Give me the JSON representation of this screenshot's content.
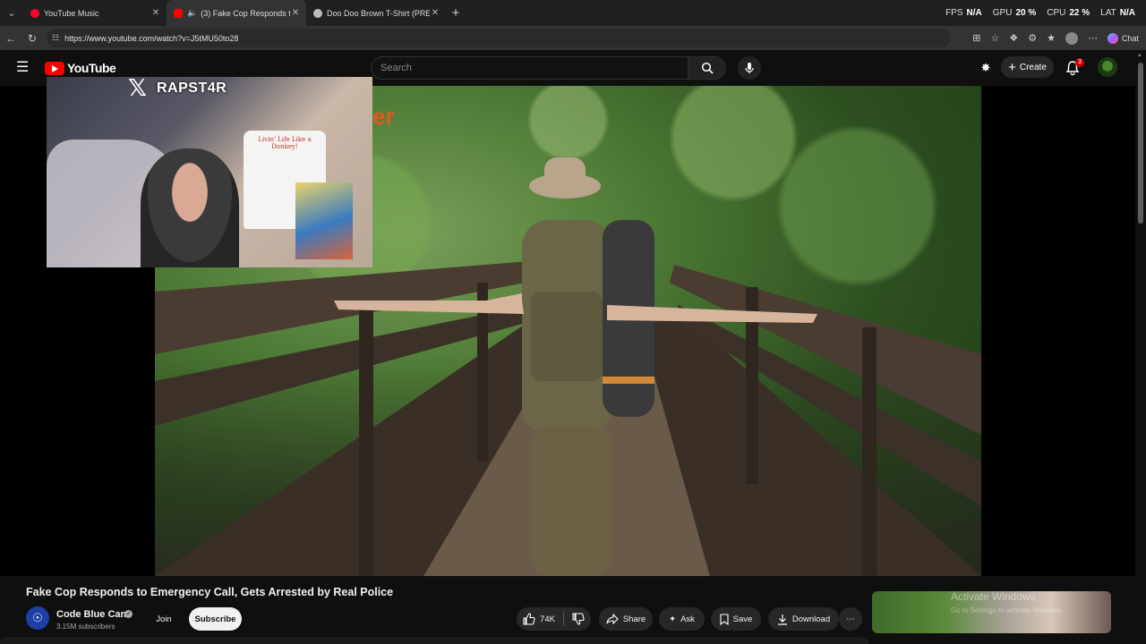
{
  "browser": {
    "tabs": [
      {
        "title": "YouTube Music",
        "favicon_color": "#ff0033"
      },
      {
        "title": "(3) Fake Cop Responds to Em",
        "favicon_color": "#ff0000",
        "active": true
      },
      {
        "title": "Doo Doo Brown T-Shirt (PRE-ORD",
        "favicon_color": "#bbbbbb"
      }
    ],
    "url": "https://www.youtube.com/watch?v=J5tMU50to28",
    "chat_label": "Chat",
    "perf": {
      "fps_label": "FPS",
      "fps_value": "N/A",
      "gpu_label": "GPU",
      "gpu_value": "20 %",
      "cpu_label": "CPU",
      "cpu_value": "22 %",
      "lat_label": "LAT",
      "lat_value": "N/A"
    }
  },
  "youtube": {
    "logo_text": "YouTube",
    "search_placeholder": "Search",
    "create_label": "Create",
    "notification_count": "3",
    "accent_color": "#ff0000"
  },
  "player": {
    "overlay_text": "er",
    "stream_handle": "RAPST4R",
    "shirt_text": "Livin' Life Like a Donkey!"
  },
  "video": {
    "title": "Fake Cop Responds to Emergency Call, Gets Arrested by Real Police",
    "channel_name": "Code Blue Cam",
    "subscribers": "3.15M subscribers",
    "join_label": "Join",
    "subscribe_label": "Subscribe",
    "likes": "74K",
    "share_label": "Share",
    "ask_label": "Ask",
    "save_label": "Save",
    "download_label": "Download"
  },
  "os_watermark": {
    "title": "Activate Windows",
    "subtitle": "Go to Settings to activate Windows."
  }
}
